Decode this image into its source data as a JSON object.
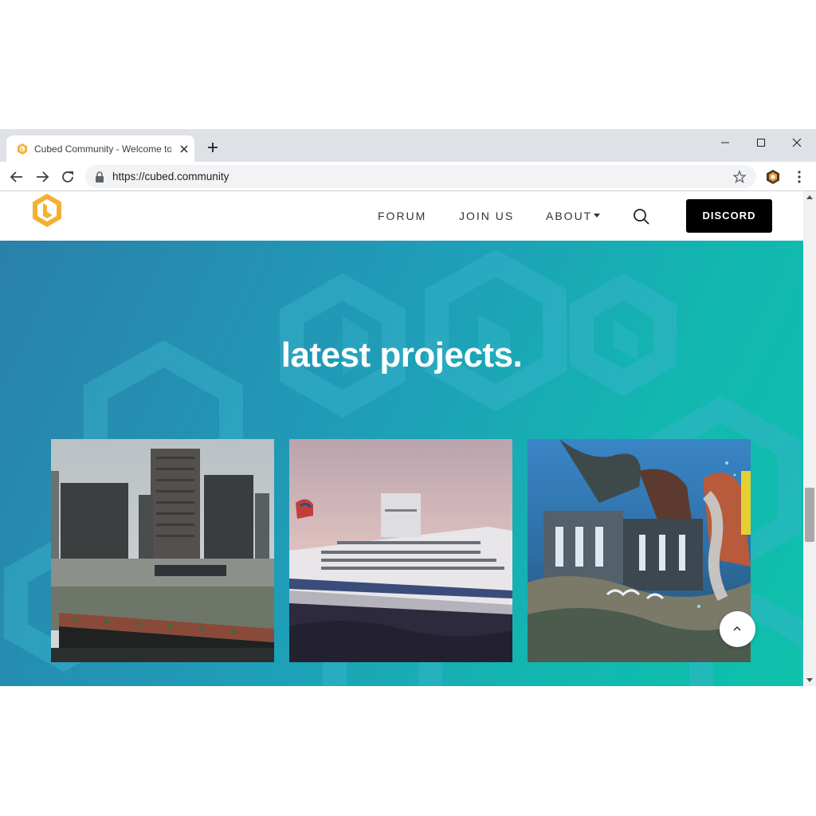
{
  "browser": {
    "tab_title": "Cubed Community - Welcome to",
    "url": "https://cubed.community"
  },
  "site": {
    "nav": {
      "forum": "FORUM",
      "join": "JOIN US",
      "about": "ABOUT",
      "discord": "DISCORD"
    },
    "hero": {
      "title": "latest projects."
    }
  },
  "colors": {
    "brand": "#f3b133",
    "hero_start": "#2a80aa",
    "hero_end": "#0fc0aa",
    "discord_button": "#000000"
  },
  "icons": [
    "cubed-logo-icon",
    "close-icon",
    "plus-icon",
    "minimize-icon",
    "maximize-icon",
    "back-arrow-icon",
    "forward-arrow-icon",
    "reload-icon",
    "lock-icon",
    "star-icon",
    "extension-icon",
    "more-vert-icon",
    "search-icon",
    "chevron-down-icon",
    "chevron-up-icon"
  ]
}
